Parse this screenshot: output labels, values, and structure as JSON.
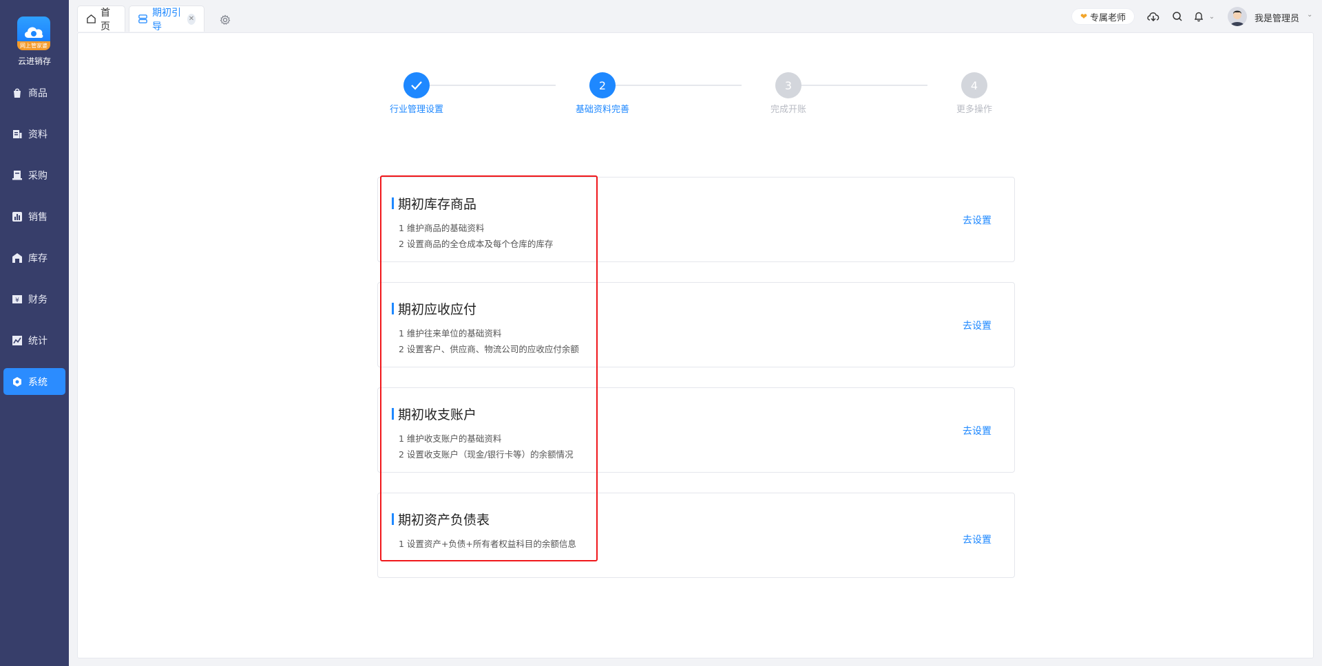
{
  "app": {
    "logo_banner": "网上管家婆",
    "name": "云进销存"
  },
  "sidebar": {
    "items": [
      {
        "label": "商品",
        "icon": "bag-icon"
      },
      {
        "label": "资料",
        "icon": "document-icon"
      },
      {
        "label": "采购",
        "icon": "purchase-icon"
      },
      {
        "label": "销售",
        "icon": "chart-bar-icon"
      },
      {
        "label": "库存",
        "icon": "warehouse-icon"
      },
      {
        "label": "财务",
        "icon": "finance-icon"
      },
      {
        "label": "统计",
        "icon": "trend-icon"
      },
      {
        "label": "系统",
        "icon": "hexagon-icon",
        "active": true
      }
    ]
  },
  "tabs": [
    {
      "label": "首页",
      "icon": "home-icon"
    },
    {
      "label": "期初引导",
      "icon": "server-icon",
      "active": true
    }
  ],
  "header": {
    "teacher": "专属老师",
    "user_name": "我是管理员"
  },
  "steps": [
    {
      "label": "行业管理设置",
      "status": "done"
    },
    {
      "label": "基础资料完善",
      "number": "2",
      "status": "current"
    },
    {
      "label": "完成开账",
      "number": "3",
      "status": "pending"
    },
    {
      "label": "更多操作",
      "number": "4",
      "status": "pending"
    }
  ],
  "cards": [
    {
      "title": "期初库存商品",
      "lines": [
        "1 维护商品的基础资料",
        "2 设置商品的全仓成本及每个仓库的库存"
      ],
      "action": "去设置"
    },
    {
      "title": "期初应收应付",
      "lines": [
        "1 维护往来单位的基础资料",
        "2 设置客户、供应商、物流公司的应收应付余额"
      ],
      "action": "去设置"
    },
    {
      "title": "期初收支账户",
      "lines": [
        "1 维护收支账户的基础资料",
        "2 设置收支账户（现金/银行卡等）的余额情况"
      ],
      "action": "去设置"
    },
    {
      "title": "期初资产负债表",
      "lines": [
        "1 设置资产+负债+所有者权益科目的余额信息"
      ],
      "action": "去设置"
    }
  ],
  "colors": {
    "sidebar_bg": "#373e6a",
    "accent": "#1e88ff",
    "highlight_outline": "#f0161a"
  }
}
